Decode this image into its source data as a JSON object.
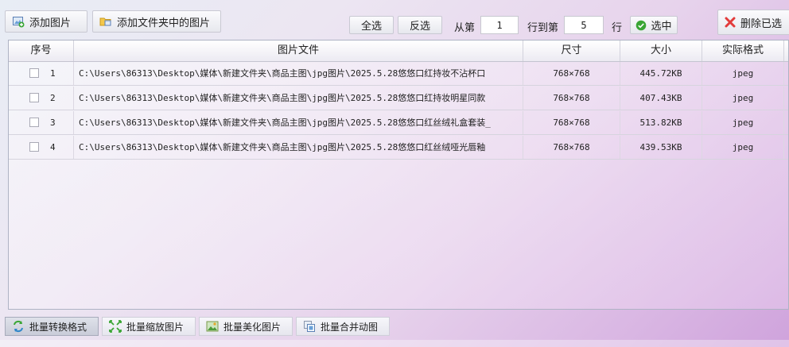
{
  "toolbar": {
    "add_image_label": "添加图片",
    "add_folder_label": "添加文件夹中的图片",
    "select_all_label": "全选",
    "invert_label": "反选",
    "from_label": "从第",
    "from_value": "1",
    "to_label": "行到第",
    "to_value": "5",
    "row_label": "行",
    "select_label": "选中",
    "delete_selected_label": "删除已选"
  },
  "table": {
    "columns": [
      "序号",
      "图片文件",
      "尺寸",
      "大小",
      "实际格式"
    ],
    "rows": [
      {
        "index": "1",
        "path": "C:\\Users\\86313\\Desktop\\媒体\\新建文件夹\\商品主图\\jpg图片\\2025.5.28悠悠口红持妆不沾杯口",
        "size": "768×768",
        "filesize": "445.72KB",
        "format": "jpeg"
      },
      {
        "index": "2",
        "path": "C:\\Users\\86313\\Desktop\\媒体\\新建文件夹\\商品主图\\jpg图片\\2025.5.28悠悠口红持妆明星同款",
        "size": "768×768",
        "filesize": "407.43KB",
        "format": "jpeg"
      },
      {
        "index": "3",
        "path": "C:\\Users\\86313\\Desktop\\媒体\\新建文件夹\\商品主图\\jpg图片\\2025.5.28悠悠口红丝绒礼盒套装_",
        "size": "768×768",
        "filesize": "513.82KB",
        "format": "jpeg"
      },
      {
        "index": "4",
        "path": "C:\\Users\\86313\\Desktop\\媒体\\新建文件夹\\商品主图\\jpg图片\\2025.5.28悠悠口红丝绒哑光唇釉",
        "size": "768×768",
        "filesize": "439.53KB",
        "format": "jpeg"
      }
    ]
  },
  "bottom_tabs": [
    {
      "label": "批量转换格式",
      "active": true
    },
    {
      "label": "批量缩放图片",
      "active": false
    },
    {
      "label": "批量美化图片",
      "active": false
    },
    {
      "label": "批量合并动图",
      "active": false
    }
  ],
  "colors": {
    "accent_green": "#3aa635",
    "delete_red": "#e23b3b"
  }
}
